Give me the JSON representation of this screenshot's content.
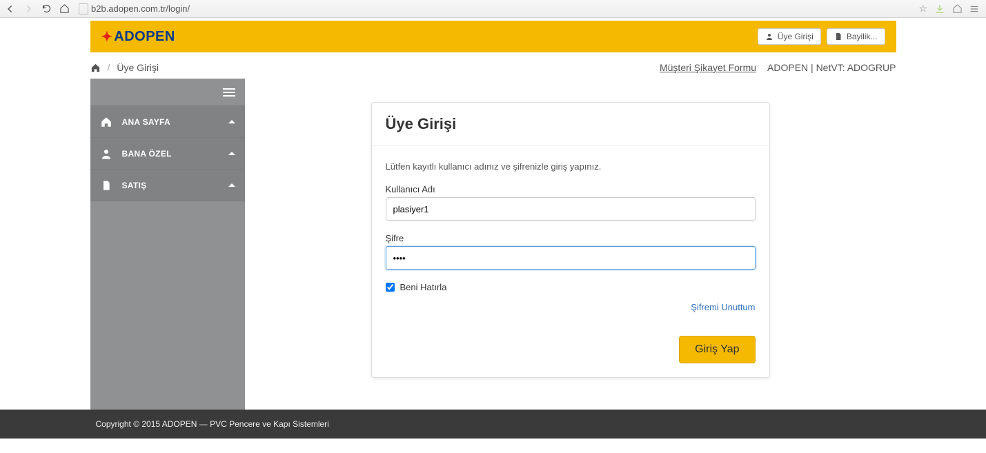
{
  "browser": {
    "url": "b2b.adopen.com.tr/login/"
  },
  "header": {
    "logo_text": "ADOPEN",
    "btn_login": "Üye Girişi",
    "btn_dealer": "Bayilik..."
  },
  "breadcrumb": {
    "current": "Üye Girişi",
    "complaint_link": "Müşteri Şikayet Formu",
    "right_text": "ADOPEN | NetVT: ADOGRUP"
  },
  "sidebar": {
    "items": [
      {
        "label": "ANA SAYFA"
      },
      {
        "label": "BANA ÖZEL"
      },
      {
        "label": "SATIŞ"
      }
    ]
  },
  "login": {
    "title": "Üye Girişi",
    "note": "Lütfen kayıtlı kullanıcı adınız ve şifrenizle giriş yapınız.",
    "username_label": "Kullanıcı Adı",
    "username_value": "plasiyer1",
    "password_label": "Şifre",
    "password_value": "••••",
    "remember_label": "Beni Hatırla",
    "forgot_label": "Şifremi Unuttum",
    "submit_label": "Giriş Yap"
  },
  "footer": {
    "text": "Copyright © 2015 ADOPEN — PVC Pencere ve Kapı Sistemleri"
  }
}
